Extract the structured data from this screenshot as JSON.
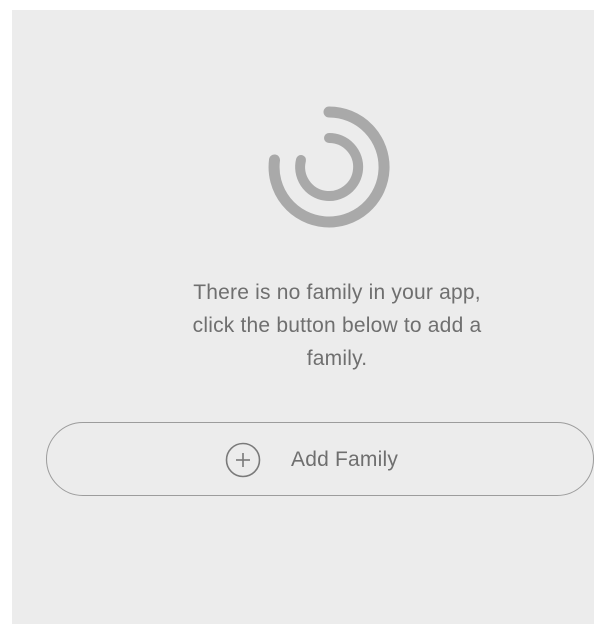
{
  "empty_state": {
    "icon": "concentric-rings-icon",
    "message": "There is no family in your app,\nclick the button below to add a\nfamily."
  },
  "add_button": {
    "icon": "plus-circle-icon",
    "label": "Add Family"
  },
  "colors": {
    "background": "#ececec",
    "text": "#6f6f6f",
    "icon": "#a9a9a9",
    "border": "#9c9c9c"
  }
}
